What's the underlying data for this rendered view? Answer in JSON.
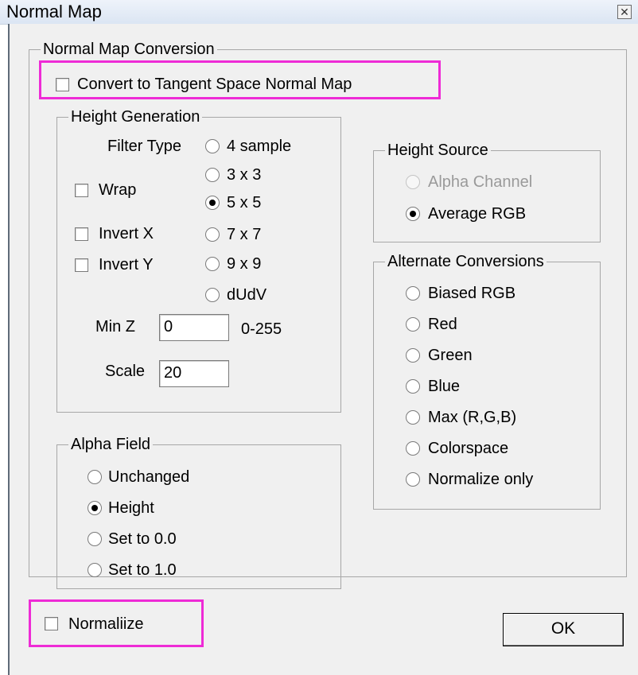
{
  "window": {
    "title": "Normal Map",
    "close_icon": "close-icon"
  },
  "conversion": {
    "legend": "Normal Map Conversion",
    "tangent_label": "Convert to Tangent Space Normal Map",
    "tangent_checked": false
  },
  "height_generation": {
    "legend": "Height Generation",
    "filter_label": "Filter Type",
    "filters": [
      {
        "label": "4 sample",
        "selected": false
      },
      {
        "label": "3 x 3",
        "selected": false
      },
      {
        "label": "5 x 5",
        "selected": true
      },
      {
        "label": "7 x 7",
        "selected": false
      },
      {
        "label": "9 x 9",
        "selected": false
      },
      {
        "label": "dUdV",
        "selected": false
      }
    ],
    "wrap": {
      "label": "Wrap",
      "checked": false
    },
    "invert_x": {
      "label": "Invert X",
      "checked": false
    },
    "invert_y": {
      "label": "Invert Y",
      "checked": false
    },
    "min_z": {
      "label": "Min Z",
      "value": "0",
      "range": "0-255"
    },
    "scale": {
      "label": "Scale",
      "value": "20"
    }
  },
  "alpha_field": {
    "legend": "Alpha Field",
    "options": [
      {
        "label": "Unchanged",
        "selected": false
      },
      {
        "label": "Height",
        "selected": true
      },
      {
        "label": "Set to 0.0",
        "selected": false
      },
      {
        "label": "Set to 1.0",
        "selected": false
      }
    ]
  },
  "height_source": {
    "legend": "Height Source",
    "options": [
      {
        "label": "Alpha Channel",
        "selected": false,
        "disabled": true
      },
      {
        "label": "Average RGB",
        "selected": true,
        "disabled": false
      }
    ]
  },
  "alternate": {
    "legend": "Alternate Conversions",
    "options": [
      {
        "label": "Biased RGB",
        "selected": false
      },
      {
        "label": "Red",
        "selected": false
      },
      {
        "label": "Green",
        "selected": false
      },
      {
        "label": "Blue",
        "selected": false
      },
      {
        "label": "Max (R,G,B)",
        "selected": false
      },
      {
        "label": "Colorspace",
        "selected": false
      },
      {
        "label": "Normalize only",
        "selected": false
      }
    ]
  },
  "normalize": {
    "label": "Normaliize",
    "checked": false
  },
  "ok_label": "OK",
  "highlight_color": "#ee2bd6"
}
